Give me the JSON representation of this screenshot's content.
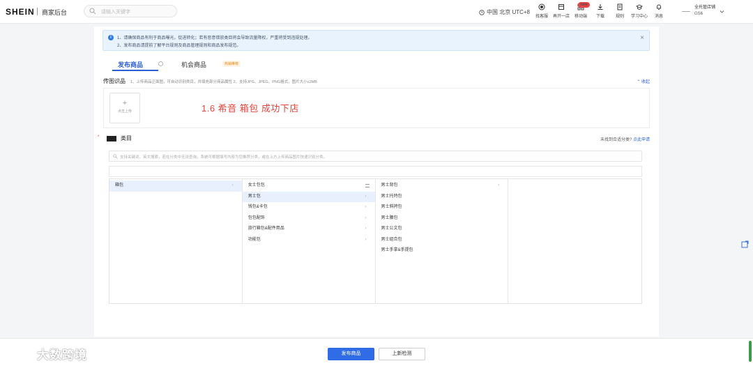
{
  "header": {
    "logo": "SHEIN",
    "subtitle": "商家后台",
    "search_placeholder": "请输入关键字",
    "region": "中国 北京 UTC+8",
    "tools": [
      {
        "label": "找客服",
        "icon": "headset-icon"
      },
      {
        "label": "再开一店",
        "icon": "store-icon"
      },
      {
        "label": "移动端",
        "icon": "grid-icon",
        "badge": "new"
      },
      {
        "label": "下载",
        "icon": "download-icon"
      },
      {
        "label": "规则",
        "icon": "rules-icon"
      },
      {
        "label": "学习中心",
        "icon": "learn-icon"
      },
      {
        "label": "消息",
        "icon": "bell-icon"
      }
    ],
    "store_name": "全托管店铺",
    "store_code": "GS6"
  },
  "notice": {
    "line1": "1、请确保商品有利于商品曝光，促进转化；若有恶意错放类目将会导致流量降权，严重将受到违规处理。",
    "line2": "2、发布商品请提前了解平台规则及商品管理规则和商品发布规范。"
  },
  "tabs": [
    {
      "label": "发布商品",
      "active": true
    },
    {
      "label": "机会商品",
      "badge": "热销推荐"
    }
  ],
  "image_recognition": {
    "title": "传图识品",
    "tip": "1、上传商品正面图，可自动识别类目，并填充部分商品属性   2、支持JPG、JPEG、PNG格式，图片大小≤3MB",
    "collapse_label": "收起",
    "upload_label": "点击上传"
  },
  "overlay_text": "1.6  希音 箱包 成功下店",
  "category": {
    "required_mark": "*",
    "title": "类目",
    "not_found": "未找到合适分类?",
    "apply_link": "点此申请",
    "search_placeholder": "支持关键词、英文搜索，若在分类中无法查询，系统可根据填写内容为您推荐分类，或在上方上传商品图片快速识别分类。",
    "columns": [
      [
        {
          "label": "箱包",
          "selected": true,
          "arrow": true
        }
      ],
      [
        {
          "label": "女士包包",
          "grid": true
        },
        {
          "label": "男士包",
          "selected": true,
          "arrow": true
        },
        {
          "label": "钱包&卡包",
          "arrow": true
        },
        {
          "label": "包包配饰",
          "arrow": true
        },
        {
          "label": "旅行箱包&配件用品",
          "arrow": true
        },
        {
          "label": "功能包",
          "arrow": true
        }
      ],
      [
        {
          "label": "男士背包",
          "arrow": true
        },
        {
          "label": "男士托特包"
        },
        {
          "label": "男士斜挎包"
        },
        {
          "label": "男士腰包"
        },
        {
          "label": "男士公文包"
        },
        {
          "label": "男士组合包"
        },
        {
          "label": "男士手拿&手提包"
        }
      ],
      []
    ]
  },
  "footer": {
    "publish_label": "发布商品",
    "save_label": "上新检测"
  },
  "watermark": "大数跨境",
  "colors": {
    "primary": "#2f6ce5",
    "accent_red": "#e5443a",
    "notice_bg": "#e9f3fd"
  }
}
